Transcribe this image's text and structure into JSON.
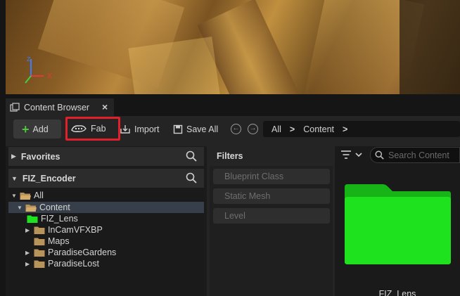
{
  "viewport": {
    "axis_x_label": "X"
  },
  "tab": {
    "title": "Content Browser",
    "close_glyph": "×"
  },
  "toolbar": {
    "add_label": "Add",
    "fab_label": "Fab",
    "import_label": "Import",
    "save_all_label": "Save All",
    "back_glyph": "←",
    "forward_glyph": "→"
  },
  "breadcrumb": {
    "items": [
      "All",
      "Content"
    ],
    "separator": ">"
  },
  "favorites": {
    "label": "Favorites"
  },
  "project": {
    "label": "FIZ_Encoder"
  },
  "tree": {
    "items": [
      {
        "label": "All"
      },
      {
        "label": "Content"
      },
      {
        "label": "FIZ_Lens"
      },
      {
        "label": "InCamVFXBP"
      },
      {
        "label": "Maps"
      },
      {
        "label": "ParadiseGardens"
      },
      {
        "label": "ParadiseLost"
      }
    ]
  },
  "filters": {
    "title": "Filters",
    "items": [
      "Blueprint Class",
      "Static Mesh",
      "Level"
    ]
  },
  "content": {
    "search_placeholder": "Search Content",
    "tiles": [
      {
        "label": "FIZ_Lens",
        "color": "#1fe21f"
      }
    ]
  },
  "colors": {
    "folder": "#b8935a",
    "folder_lens": "#1fe21f",
    "fab_highlight": "#e0202a",
    "add_plus": "#4fc93a"
  }
}
